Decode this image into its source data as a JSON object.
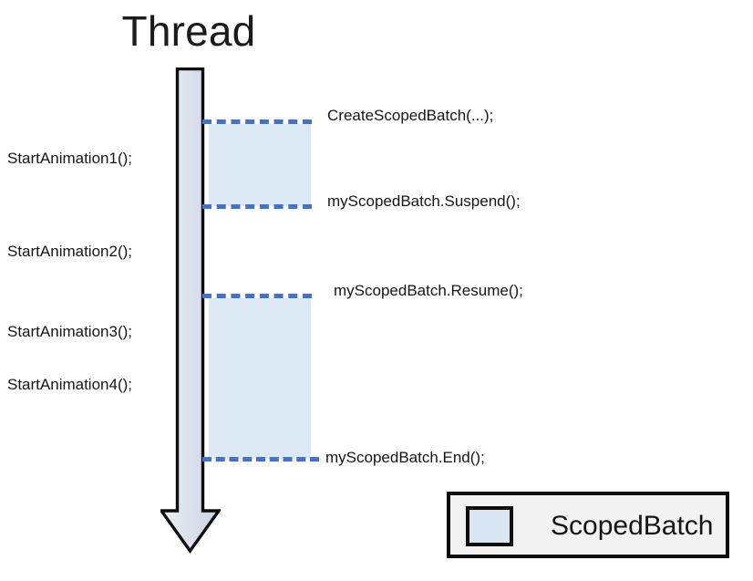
{
  "diagram": {
    "title": "Thread",
    "thread_arrow": {
      "icon": "down-arrow-icon",
      "direction": "down"
    },
    "left_labels": [
      {
        "text": "StartAnimation1();"
      },
      {
        "text": "StartAnimation2();"
      },
      {
        "text": "StartAnimation3();"
      },
      {
        "text": "StartAnimation4();"
      }
    ],
    "right_labels": [
      {
        "text": "CreateScopedBatch(...);"
      },
      {
        "text": "myScopedBatch.Suspend();"
      },
      {
        "text": "myScopedBatch.Resume();"
      },
      {
        "text": "myScopedBatch.End();"
      }
    ],
    "scoped_batch_regions": [
      {
        "name": "first-scoped-batch-region",
        "start_marker": "CreateScopedBatch(...);",
        "end_marker": "myScopedBatch.Suspend();"
      },
      {
        "name": "second-scoped-batch-region",
        "start_marker": "myScopedBatch.Resume();",
        "end_marker": "myScopedBatch.End();"
      }
    ],
    "legend": {
      "swatch_label": "ScopedBatch"
    },
    "colors": {
      "background": "#ffffff",
      "batch_fill": "#dde8f5",
      "dashed_line": "#4472c4",
      "arrow_outline": "#0d0d0d",
      "arrow_fill_top": "#e8edf4",
      "arrow_fill_bottom": "#c3ccdb",
      "text": "#151515",
      "legend_background": "#f2f2f2",
      "legend_border": "#0d0d0d",
      "legend_swatch_fill": "#dae6f3"
    }
  }
}
